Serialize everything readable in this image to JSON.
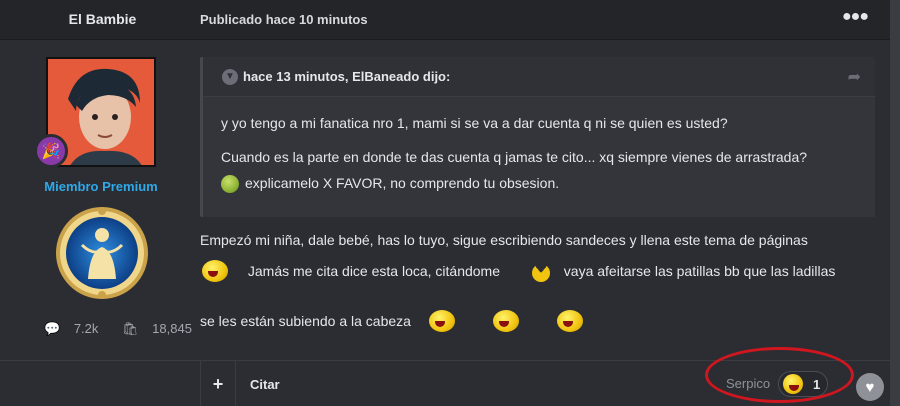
{
  "post": {
    "author": "El Bambie",
    "published": "Publicado hace 10 minutos",
    "member_title": "Miembro Premium",
    "stats": {
      "comments": "7.2k",
      "points": "18,845"
    }
  },
  "quote": {
    "header": "hace 13 minutos, ElBaneado dijo:",
    "paragraphs": [
      "y yo tengo a mi fanatica nro 1, mami si se va a dar cuenta q ni se quien es usted?",
      "Cuando es la parte en donde te das cuenta q jamas te cito... xq siempre vienes de arrastrada?",
      "explicamelo X FAVOR, no comprendo tu obsesion."
    ]
  },
  "message": {
    "line1": "Empezó mi niña, dale bebé, has lo tuyo, sigue escribiendo sandeces y llena este tema de páginas",
    "line2a": "Jamás me cita dice esta loca, citándome",
    "line2b": "vaya afeitarse las patillas bb que las ladillas",
    "line3": "se les están subiendo a la cabeza"
  },
  "footer": {
    "add_label": "+",
    "quote_label": "Citar",
    "reaction_user": "Serpico",
    "reaction_count": "1"
  },
  "icons": [
    "more-icon",
    "chevron-down-icon",
    "share-icon",
    "party-badge-icon",
    "comment-icon",
    "bag-icon",
    "laugh-emoji-icon",
    "heart-icon"
  ],
  "colors": {
    "accent": "#2fa9e8",
    "annotation": "#d0161e",
    "background": "#2b2d33"
  }
}
